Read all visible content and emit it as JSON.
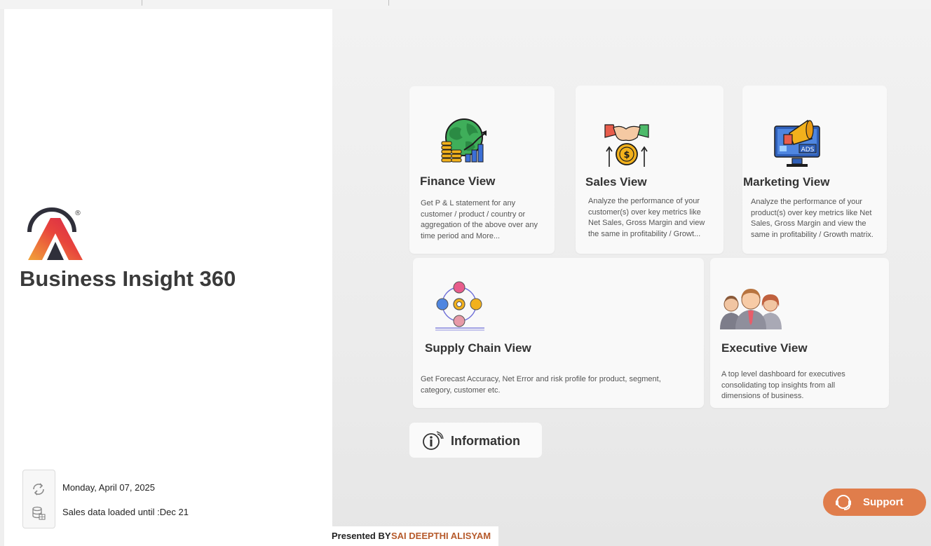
{
  "brand": {
    "title": "Business Insight 360",
    "logo_mark": "®"
  },
  "status": {
    "date": "Monday, April 07, 2025",
    "data_loaded": "Sales data loaded until :Dec 21"
  },
  "cards": [
    {
      "title": "Finance View",
      "desc": "Get P & L statement for any customer / product / country or aggregation of the above over any time period and More...",
      "icon": "globe-finance-icon"
    },
    {
      "title": "Sales View",
      "desc": "Analyze the performance of your customer(s) over key metrics like Net Sales, Gross Margin and view the same in profitability / Growt...",
      "icon": "handshake-dollar-icon"
    },
    {
      "title": "Marketing View",
      "desc": "Analyze the performance of your product(s) over key metrics like Net Sales, Gross Margin and view the same in profitability / Growth matrix.",
      "icon": "megaphone-monitor-icon"
    },
    {
      "title": "Supply Chain View",
      "desc": "Get Forecast Accuracy, Net Error and risk profile for product, segment, category, customer etc.",
      "icon": "supply-chain-icon"
    },
    {
      "title": "Executive View",
      "desc": "A top level dashboard for executives consolidating top insights from all dimensions of business.",
      "icon": "executives-icon"
    }
  ],
  "information": {
    "label": "Information"
  },
  "support": {
    "label": "Support"
  },
  "footer": {
    "presented_by": "Presented BY",
    "name": "SAI DEEPTHI ALISYAM"
  },
  "colors": {
    "accent": "#e07d4b",
    "name_color": "#b65a2b"
  }
}
